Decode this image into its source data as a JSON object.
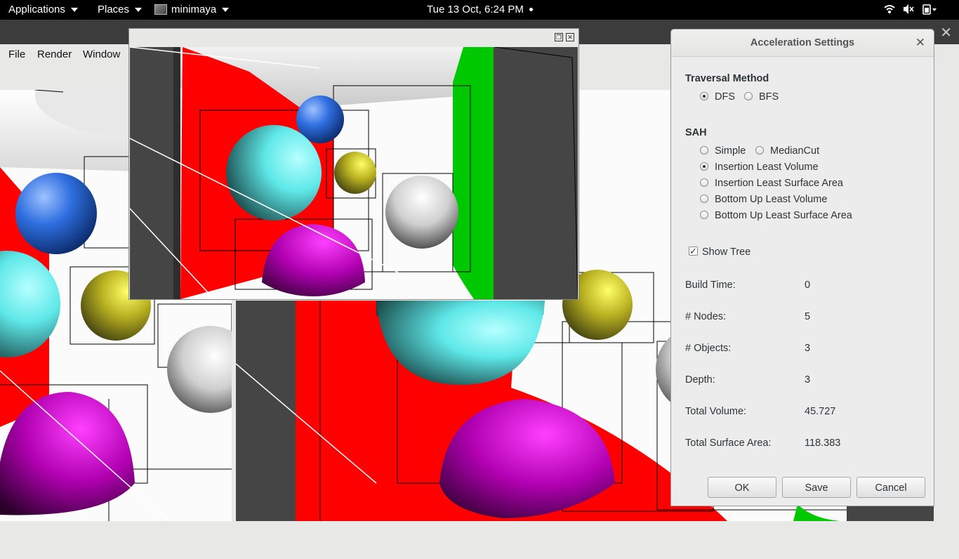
{
  "topbar": {
    "applications": "Applications",
    "places": "Places",
    "app_name": "minimaya",
    "clock": "Tue 13 Oct,  6:24 PM"
  },
  "menubar": {
    "file": "File",
    "render": "Render",
    "window": "Window"
  },
  "dialog": {
    "title": "Acceleration Settings",
    "traversal_heading": "Traversal Method",
    "traversal_options": [
      "DFS",
      "BFS"
    ],
    "traversal_selected": "DFS",
    "sah_heading": "SAH",
    "sah_options": [
      "Simple",
      "MedianCut",
      "Insertion Least Volume",
      "Insertion Least Surface Area",
      "Bottom Up Least Volume",
      "Bottom Up Least Surface Area"
    ],
    "sah_selected": "Insertion Least Volume",
    "show_tree_label": "Show Tree",
    "show_tree_checked": true,
    "stats": [
      {
        "label": "Build Time:",
        "value": "0"
      },
      {
        "label": "# Nodes:",
        "value": "5"
      },
      {
        "label": "# Objects:",
        "value": "3"
      },
      {
        "label": "Depth:",
        "value": "3"
      },
      {
        "label": "Total Volume:",
        "value": "45.727"
      },
      {
        "label": "Total Surface Area:",
        "value": "118.383"
      }
    ],
    "buttons": {
      "ok": "OK",
      "save": "Save",
      "cancel": "Cancel"
    }
  },
  "colors": {
    "topbar": "#000000",
    "red_wall": "#ff0000",
    "green_wall": "#00c800",
    "dialog_bg": "#ececec"
  }
}
